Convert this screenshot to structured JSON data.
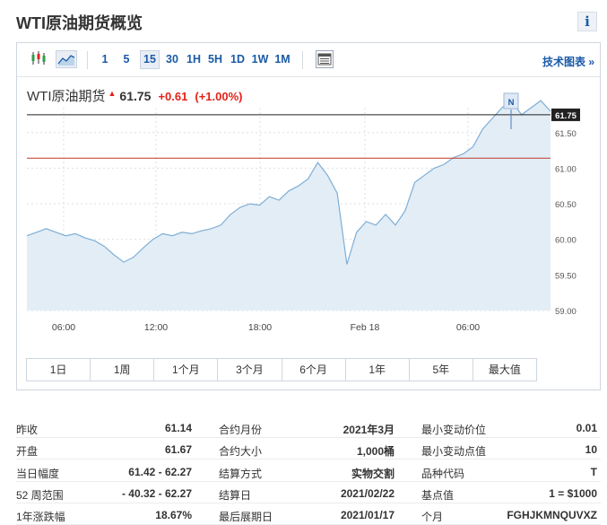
{
  "page": {
    "title": "WTI原油期货概览",
    "info_icon": "i"
  },
  "toolbar": {
    "intervals": [
      "1",
      "5",
      "15",
      "30",
      "1H",
      "5H",
      "1D",
      "1W",
      "1M"
    ],
    "active_interval": "15",
    "tech_chart_link": "技术图表 »"
  },
  "quote": {
    "name": "WTI原油期货",
    "arrow": "▲",
    "price": "61.75",
    "change": "+0.61",
    "change_pct": "(+1.00%)"
  },
  "colors": {
    "up": "#e62117",
    "link": "#1a5aa8",
    "line": "#7eaed6",
    "fill": "#e3edf6"
  },
  "chart_data": {
    "type": "area",
    "x_tick_labels": [
      "06:00",
      "12:00",
      "18:00",
      "Feb 18",
      "06:00"
    ],
    "y_tick_labels": [
      "61.75",
      "61.50",
      "61.00",
      "60.50",
      "60.00",
      "59.50",
      "59.00"
    ],
    "ylim": [
      59.0,
      61.85
    ],
    "current_price_line": 61.75,
    "reference_line": 61.14,
    "marker_label": "N",
    "series": [
      {
        "values": [
          60.05,
          60.1,
          60.15,
          60.1,
          60.05,
          60.08,
          60.02,
          59.98,
          59.9,
          59.78,
          59.68,
          59.75,
          59.88,
          60.0,
          60.08,
          60.05,
          60.1,
          60.08,
          60.12,
          60.15,
          60.2,
          60.35,
          60.45,
          60.5,
          60.48,
          60.6,
          60.55,
          60.68,
          60.75,
          60.85,
          61.08,
          60.9,
          60.65,
          59.65,
          60.1,
          60.25,
          60.2,
          60.35,
          60.2,
          60.4,
          60.8,
          60.9,
          61.0,
          61.05,
          61.15,
          61.2,
          61.3,
          61.55,
          61.7,
          61.85,
          61.95,
          61.75,
          61.85,
          61.95,
          61.8
        ]
      }
    ]
  },
  "ranges": [
    "1日",
    "1周",
    "1个月",
    "3个月",
    "6个月",
    "1年",
    "5年",
    "最大值"
  ],
  "stats": {
    "col1": [
      {
        "label": "昨收",
        "value": "61.14"
      },
      {
        "label": "开盘",
        "value": "61.67"
      },
      {
        "label": "当日幅度",
        "value": "61.42 - 62.27"
      },
      {
        "label": "52 周范围",
        "value": "- 40.32 - 62.27"
      },
      {
        "label": "1年涨跌幅",
        "value": "18.67%"
      }
    ],
    "col2": [
      {
        "label": "合约月份",
        "value": "2021年3月"
      },
      {
        "label": "合约大小",
        "value": "1,000桶"
      },
      {
        "label": "结算方式",
        "value": "实物交割"
      },
      {
        "label": "结算日",
        "value": "2021/02/22"
      },
      {
        "label": "最后展期日",
        "value": "2021/01/17"
      }
    ],
    "col3": [
      {
        "label": "最小变动价位",
        "value": "0.01"
      },
      {
        "label": "最小变动点值",
        "value": "10"
      },
      {
        "label": "品种代码",
        "value": "T"
      },
      {
        "label": "基点值",
        "value": "1 = $1000"
      },
      {
        "label": "个月",
        "value": "FGHJKMNQUVXZ"
      }
    ]
  }
}
